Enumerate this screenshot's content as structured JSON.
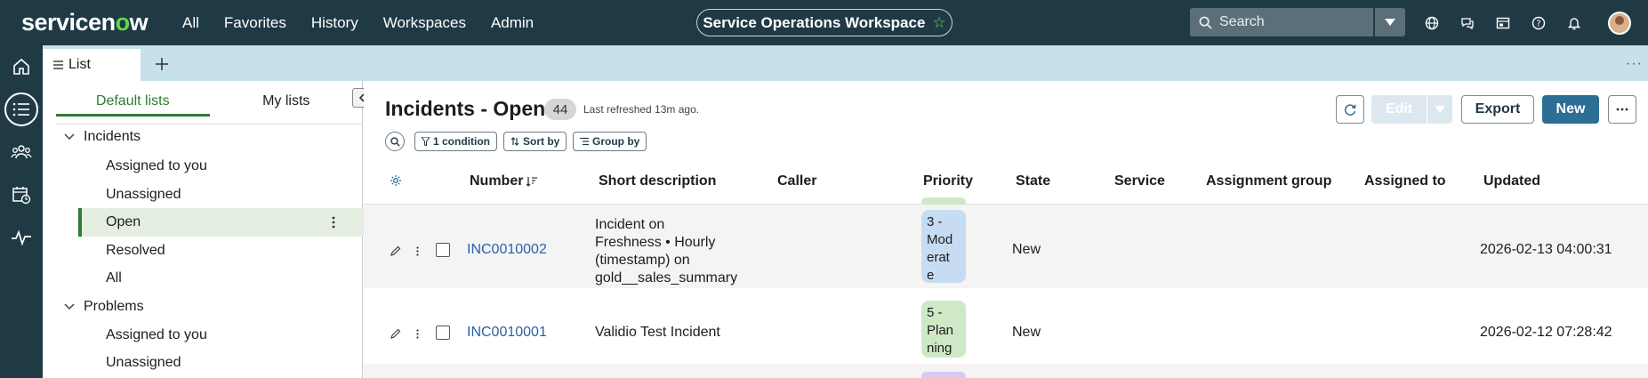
{
  "topnav": {
    "logo_prefix": "servicen",
    "logo_o": "o",
    "logo_suffix": "w",
    "links": [
      "All",
      "Favorites",
      "History",
      "Workspaces",
      "Admin"
    ],
    "workspace": "Service Operations Workspace",
    "search_placeholder": "Search",
    "icons": [
      "globe-icon",
      "chat-icon",
      "form-icon",
      "help-icon",
      "bell-icon"
    ]
  },
  "tabs": {
    "current": "List"
  },
  "left_panel": {
    "tabs": [
      "Default lists",
      "My lists"
    ],
    "selected_tab": "Default lists",
    "groups": [
      {
        "label": "Incidents",
        "items": [
          "Assigned to you",
          "Unassigned",
          "Open",
          "Resolved",
          "All"
        ]
      },
      {
        "label": "Problems",
        "items": [
          "Assigned to you",
          "Unassigned"
        ]
      }
    ],
    "selected_item": "Open"
  },
  "main": {
    "title": "Incidents - Open",
    "count": "44",
    "refreshed": "Last refreshed 13m ago.",
    "buttons": {
      "edit": "Edit",
      "export": "Export",
      "new": "New"
    },
    "chips": {
      "condition": "1 condition",
      "sort": "Sort by",
      "group": "Group by"
    },
    "columns": [
      "Number",
      "Short description",
      "Caller",
      "Priority",
      "State",
      "Service",
      "Assignment group",
      "Assigned to",
      "Updated"
    ],
    "rows": [
      {
        "number": "INC0010002",
        "desc": [
          "Incident on",
          "Freshness • Hourly",
          "(timestamp) on",
          "gold__sales_summary"
        ],
        "priority": [
          "3 -",
          "Mod",
          "erat",
          "e"
        ],
        "priority_color": "#c6dcf2",
        "state": "New",
        "updated": "2026-02-13 04:00:31"
      },
      {
        "number": "INC0010001",
        "desc": [
          "Validio Test Incident"
        ],
        "priority": [
          "5 -",
          "Plan",
          "ning"
        ],
        "priority_color": "#cfe8c6",
        "state": "New",
        "updated": "2026-02-12 07:28:42"
      }
    ]
  }
}
